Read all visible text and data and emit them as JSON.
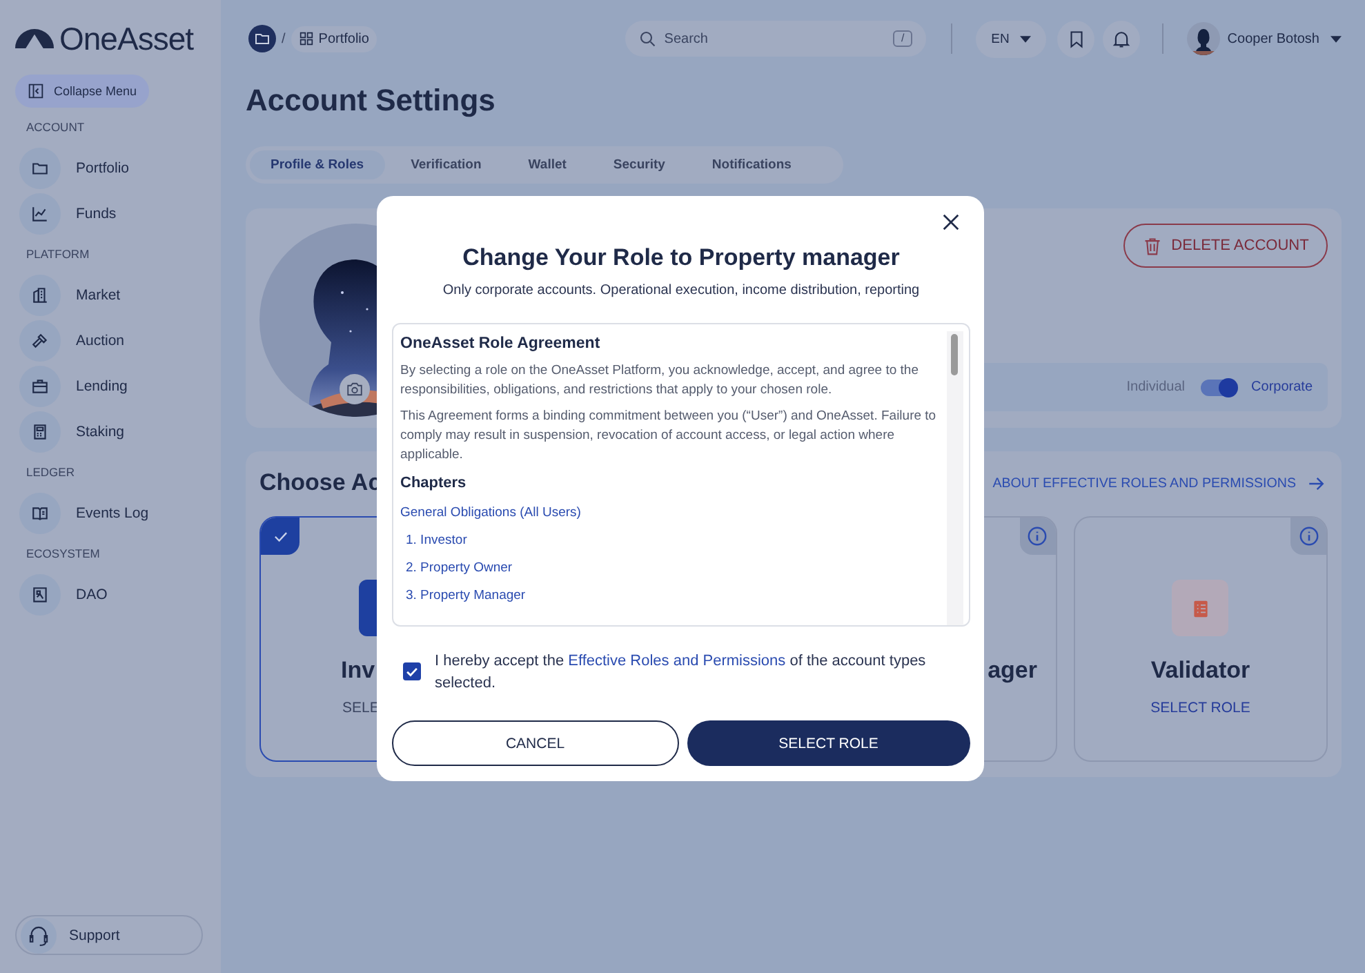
{
  "sidebar": {
    "logo": "OneAsset",
    "collapse_button": "Collapse Menu",
    "sections": [
      {
        "title": "ACCOUNT",
        "items": [
          {
            "label": "Portfolio"
          },
          {
            "label": "Funds"
          }
        ]
      },
      {
        "title": "PLATFORM",
        "items": [
          {
            "label": "Market"
          },
          {
            "label": "Auction"
          },
          {
            "label": "Lending"
          },
          {
            "label": "Staking"
          }
        ]
      },
      {
        "title": "LEDGER",
        "items": [
          {
            "label": "Events Log"
          }
        ]
      },
      {
        "title": "ECOSYSTEM",
        "items": [
          {
            "label": "DAO"
          }
        ]
      }
    ],
    "support": "Support"
  },
  "header": {
    "breadcrumb_separator": "/",
    "breadcrumb": "Portfolio",
    "search": {
      "placeholder": "Search",
      "shortcut": "/"
    },
    "language": "EN",
    "user_name": "Cooper Botosh"
  },
  "page_title": "Account Settings",
  "tabs": [
    {
      "label": "Profile & Roles",
      "selected": true
    },
    {
      "label": "Verification",
      "selected": false
    },
    {
      "label": "Wallet",
      "selected": false
    },
    {
      "label": "Security",
      "selected": false
    },
    {
      "label": "Notifications",
      "selected": false
    }
  ],
  "profile": {
    "delete_button": "DELETE ACCOUNT",
    "account_type": {
      "left": "Individual",
      "right": "Corporate",
      "on": true
    }
  },
  "roles": {
    "title": "Choose Ac",
    "link": "ABOUT EFFECTIVE ROLES AND PERMISSIONS",
    "cards": [
      {
        "title": "Inv",
        "action": "SELE",
        "selected": true
      },
      {
        "title": "ager",
        "selected": false
      },
      {
        "title": "Validator",
        "action": "SELECT ROLE",
        "selected": false
      }
    ]
  },
  "modal": {
    "title": "Change Your Role to Property manager",
    "subtitle": "Only corporate accounts. Operational execution, income distribution, reporting",
    "agreement": {
      "heading": "OneAsset Role Agreement",
      "paragraphs": [
        "By selecting a role on the OneAsset Platform, you acknowledge, accept, and agree to the responsibilities, obligations, and restrictions that apply to your chosen role.",
        "This Agreement forms a binding commitment between you (“User”) and OneAsset. Failure to comply may result in suspension, revocation of account access, or legal action where applicable."
      ],
      "chapters_title": "Chapters",
      "chapters": [
        {
          "label": "General Obligations (All Users)",
          "kind": "general"
        },
        {
          "label": "1. Investor",
          "kind": "role"
        },
        {
          "label": "2. Property Owner",
          "kind": "role"
        },
        {
          "label": "3. Property Manager",
          "kind": "role"
        }
      ]
    },
    "consent": {
      "checked": true,
      "before": "I hereby accept the ",
      "link": "Effective Roles and Permissions",
      "after": " of the account types selected."
    },
    "cancel_button": "CANCEL",
    "confirm_button": "SELECT ROLE"
  }
}
